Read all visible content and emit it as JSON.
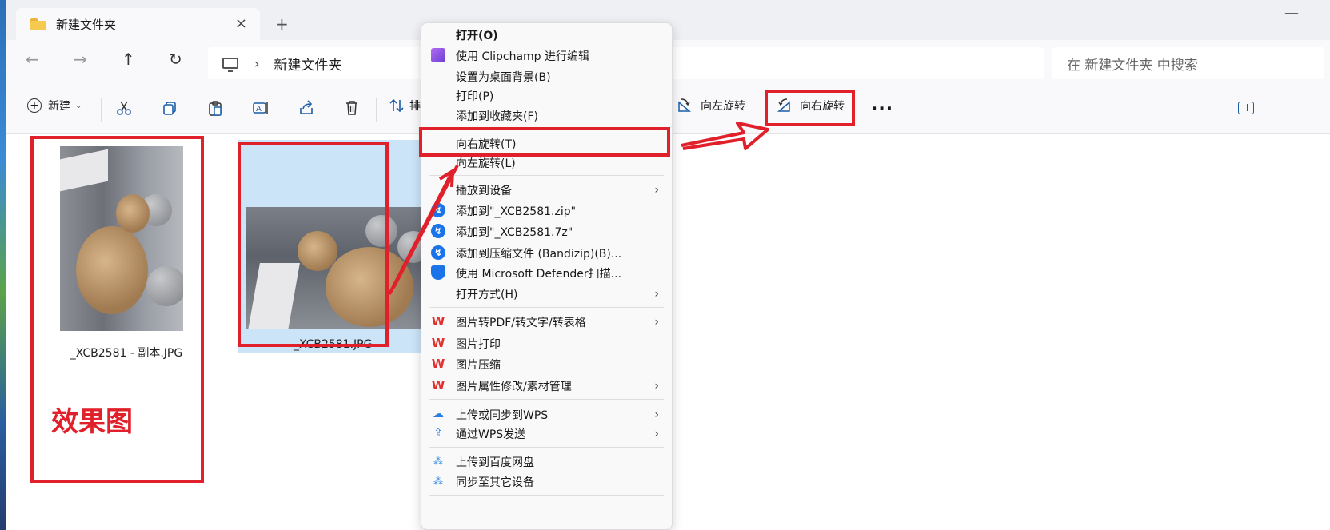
{
  "window": {
    "tab_title": "新建文件夹",
    "tab_close_icon": "×",
    "new_tab_icon": "+",
    "minimize_icon": "—"
  },
  "nav": {
    "back_icon": "←",
    "forward_icon": "→",
    "up_icon": "↑",
    "refresh_icon": "↻"
  },
  "address": {
    "path_chevron": "›",
    "folder": "新建文件夹",
    "search_placeholder": "在 新建文件夹 中搜索"
  },
  "commandbar": {
    "new_label": "新建",
    "new_icon": "+",
    "dropdown_icon": "⌄",
    "sort_label": "排",
    "rotate_left_label": "向左旋转",
    "rotate_right_label": "向右旋转",
    "more_icon": "···"
  },
  "files": [
    {
      "name": "_XCB2581 - 副本.JPG"
    },
    {
      "name": "_XCB2581.JPG"
    }
  ],
  "context_menu": {
    "items": [
      {
        "label": "打开(O)",
        "bold": true
      },
      {
        "label": "使用 Clipchamp 进行编辑",
        "icon": "clipchamp-icon"
      },
      {
        "label": "设置为桌面背景(B)"
      },
      {
        "label": "打印(P)"
      },
      {
        "label": "添加到收藏夹(F)"
      },
      {
        "label": "向右旋转(T)"
      },
      {
        "label": "向左旋转(L)"
      },
      {
        "label": "播放到设备",
        "submenu": true
      },
      {
        "label": "添加到\"_XCB2581.zip\"",
        "icon": "bandizip-icon"
      },
      {
        "label": "添加到\"_XCB2581.7z\"",
        "icon": "bandizip-icon"
      },
      {
        "label": "添加到压缩文件 (Bandizip)(B)...",
        "icon": "bandizip-icon"
      },
      {
        "label": "使用 Microsoft Defender扫描...",
        "icon": "defender-shield-icon"
      },
      {
        "label": "打开方式(H)",
        "submenu": true
      },
      {
        "label": "图片转PDF/转文字/转表格",
        "icon": "wps-icon",
        "submenu": true
      },
      {
        "label": "图片打印",
        "icon": "wps-icon"
      },
      {
        "label": "图片压缩",
        "icon": "wps-icon"
      },
      {
        "label": "图片属性修改/素材管理",
        "icon": "wps-icon",
        "submenu": true
      },
      {
        "label": "上传或同步到WPS",
        "icon": "cloud-icon",
        "submenu": true
      },
      {
        "label": "通过WPS发送",
        "icon": "send-icon",
        "submenu": true
      },
      {
        "label": "上传到百度网盘",
        "icon": "baidu-icon"
      },
      {
        "label": "同步至其它设备",
        "icon": "baidu-icon"
      }
    ],
    "submenu_arrow": "›"
  },
  "annotations": {
    "effect_label": "效果图",
    "color": "#e0202a"
  },
  "colors": {
    "selection": "#cce4f7",
    "accent": "#1b5ea8",
    "annotation_red": "#e0202a"
  }
}
